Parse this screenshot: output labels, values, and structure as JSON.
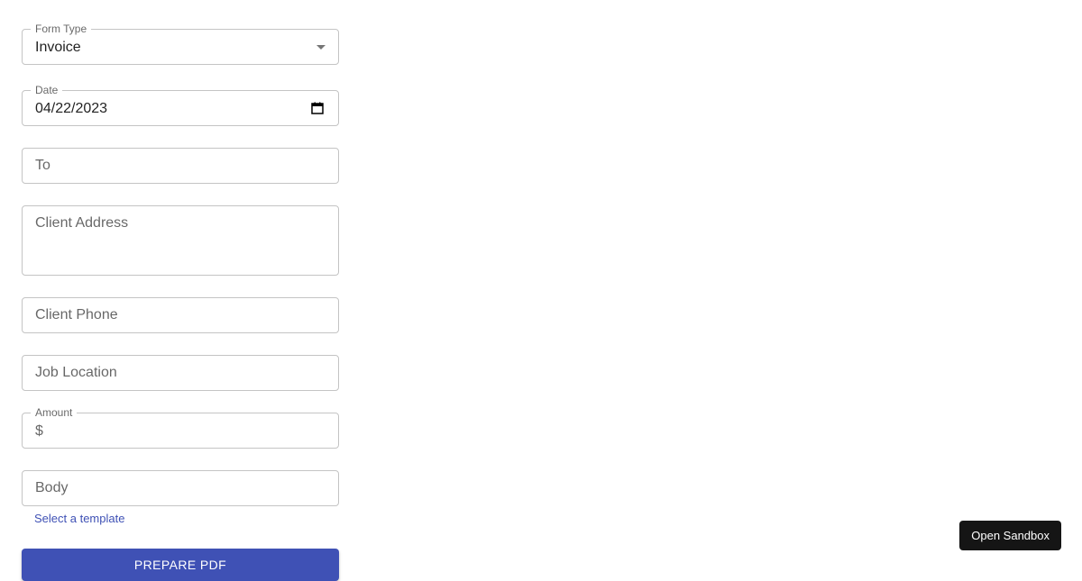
{
  "form": {
    "form_type": {
      "label": "Form Type",
      "value": "Invoice"
    },
    "date": {
      "label": "Date",
      "value": "04/22/2023"
    },
    "to": {
      "placeholder": "To"
    },
    "client_address": {
      "placeholder": "Client Address"
    },
    "client_phone": {
      "placeholder": "Client Phone"
    },
    "job_location": {
      "placeholder": "Job Location"
    },
    "amount": {
      "label": "Amount",
      "prefix": "$"
    },
    "body": {
      "placeholder": "Body"
    },
    "select_template_link": "Select a template",
    "prepare_pdf_button": "PREPARE PDF"
  },
  "sandbox_button": "Open Sandbox",
  "colors": {
    "primary": "#3f51b5",
    "sandbox_button_bg": "#151515",
    "border": "#c4c4c4"
  }
}
